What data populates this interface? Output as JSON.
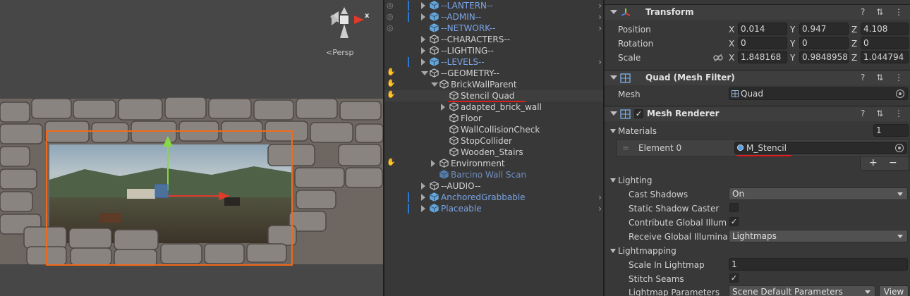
{
  "scene": {
    "persp_label": "Persp",
    "gizmo_x_label": "x"
  },
  "hierarchy": {
    "items": [
      {
        "label": "--LANTERN--",
        "style": "blue"
      },
      {
        "label": "--ADMIN--",
        "style": "blue"
      },
      {
        "label": "--NETWORK--",
        "style": "blue"
      },
      {
        "label": "--CHARACTERS--",
        "style": "grey"
      },
      {
        "label": "--LIGHTING--",
        "style": "grey"
      },
      {
        "label": "--LEVELS--",
        "style": "blue"
      },
      {
        "label": "--GEOMETRY--",
        "style": "grey"
      },
      {
        "label": "BrickWallParent",
        "style": "grey"
      },
      {
        "label": "Stencil Quad",
        "style": "grey"
      },
      {
        "label": "adapted_brick_wall",
        "style": "grey"
      },
      {
        "label": "Floor",
        "style": "grey"
      },
      {
        "label": "WallCollisionCheck",
        "style": "grey"
      },
      {
        "label": "StopCollider",
        "style": "grey"
      },
      {
        "label": "Wooden_Stairs",
        "style": "grey"
      },
      {
        "label": "Environment",
        "style": "grey"
      },
      {
        "label": "Barcino Wall Scan",
        "style": "dim"
      },
      {
        "label": "--AUDIO--",
        "style": "grey"
      },
      {
        "label": "AnchoredGrabbable",
        "style": "blue"
      },
      {
        "label": "Placeable",
        "style": "blue"
      }
    ]
  },
  "inspector": {
    "transform": {
      "title": "Transform",
      "position_label": "Position",
      "rotation_label": "Rotation",
      "scale_label": "Scale",
      "axis_x": "X",
      "axis_y": "Y",
      "axis_z": "Z",
      "position": {
        "x": "0.014",
        "y": "0.947",
        "z": "4.108"
      },
      "rotation": {
        "x": "0",
        "y": "0",
        "z": "0"
      },
      "scale": {
        "x": "1.848168",
        "y": "0.9848958",
        "z": "1.044794"
      }
    },
    "mesh_filter": {
      "title": "Quad (Mesh Filter)",
      "mesh_label": "Mesh",
      "mesh_value": "Quad"
    },
    "mesh_renderer": {
      "title": "Mesh Renderer",
      "materials_label": "Materials",
      "materials_count": "1",
      "element_label": "Element 0",
      "element_value": "M_Stencil",
      "add_label": "+",
      "remove_label": "−",
      "lighting_label": "Lighting",
      "cast_shadows_label": "Cast Shadows",
      "cast_shadows_value": "On",
      "static_shadow_label": "Static Shadow Caster",
      "contribute_gi_label": "Contribute Global Illumina",
      "receive_gi_label": "Receive Global Illuminati",
      "receive_gi_value": "Lightmaps",
      "lightmapping_label": "Lightmapping",
      "scale_lightmap_label": "Scale In Lightmap",
      "scale_lightmap_value": "1",
      "stitch_seams_label": "Stitch Seams",
      "lightmap_params_label": "Lightmap Parameters",
      "lightmap_params_value": "Scene Default Parameters",
      "view_label": "View"
    },
    "tool_icons": "? ⇅ ⋮"
  },
  "colors": {
    "accent_blue": "#2d7bd0",
    "selection_underline": "#d91f1f",
    "gizmo_x": "#e03a2a",
    "gizmo_y": "#86d943",
    "selection_outline": "#f06a1c"
  }
}
